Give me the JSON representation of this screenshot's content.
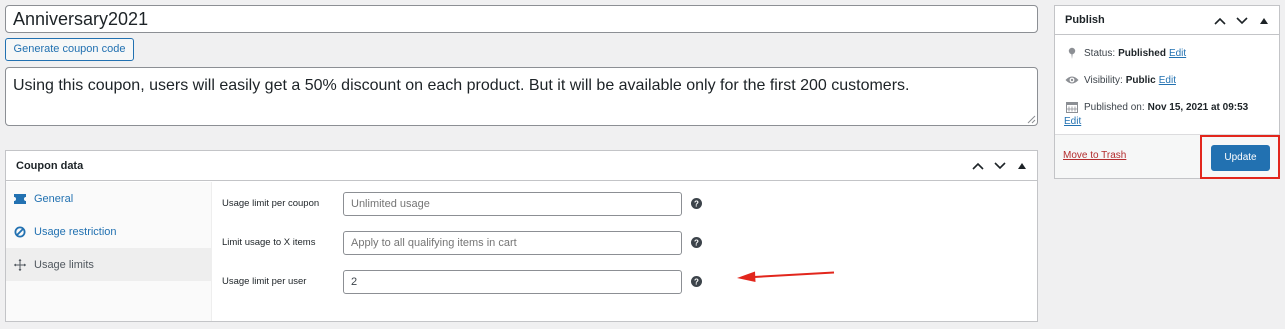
{
  "title_input": {
    "value": "Anniversary2021"
  },
  "generate_button": {
    "label": "Generate coupon code"
  },
  "description": {
    "value": "Using this coupon, users will easily get a 50% discount on each product. But it will be available only for the first 200 customers."
  },
  "coupon_data": {
    "title": "Coupon data",
    "tabs": [
      {
        "label": "General",
        "icon": "ticket-icon"
      },
      {
        "label": "Usage restriction",
        "icon": "block-icon"
      },
      {
        "label": "Usage limits",
        "icon": "arrows-icon"
      }
    ],
    "active_tab": "Usage limits",
    "fields": [
      {
        "label": "Usage limit per coupon",
        "placeholder": "Unlimited usage",
        "value": ""
      },
      {
        "label": "Limit usage to X items",
        "placeholder": "Apply to all qualifying items in cart",
        "value": ""
      },
      {
        "label": "Usage limit per user",
        "placeholder": "",
        "value": "2"
      }
    ]
  },
  "publish": {
    "title": "Publish",
    "status_label": "Status:",
    "status_value": "Published",
    "visibility_label": "Visibility:",
    "visibility_value": "Public",
    "published_on_label": "Published on:",
    "published_on_value": "Nov 15, 2021 at 09:53",
    "edit_label": "Edit",
    "trash_label": "Move to Trash",
    "update_label": "Update"
  },
  "colors": {
    "accent": "#2271b1",
    "annotation_red": "#e2261c",
    "trash_red": "#b32d2e",
    "background": "#f0f0f1"
  }
}
